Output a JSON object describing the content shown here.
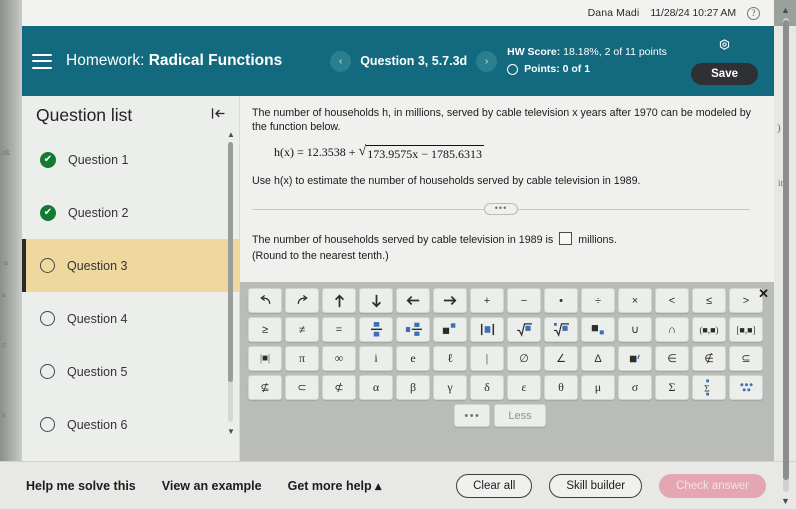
{
  "userbar": {
    "user_name": "Dana Madi",
    "timestamp": "11/28/24 10:27 AM",
    "help_icon": "?"
  },
  "header": {
    "menu_icon": "hamburger-icon",
    "title_label": "Homework:",
    "title_value": "Radical Functions",
    "prev_icon": "‹",
    "next_icon": "›",
    "question_nav_label": "Question 3, 5.7.3d",
    "hw_score": "HW Score: 18.18%, 2 of 11 points",
    "hw_score_bold": "HW Score:",
    "hw_score_rest": " 18.18%, 2 of 11 points",
    "points_label": "Points: 0 of 1",
    "gear_icon": "⚙",
    "save_label": "Save",
    "bg_color": "#136a7f"
  },
  "sidebar": {
    "title": "Question list",
    "collapse_icon": "|←",
    "items": [
      {
        "label": "Question 1",
        "status": "done"
      },
      {
        "label": "Question 2",
        "status": "done"
      },
      {
        "label": "Question 3",
        "status": "current"
      },
      {
        "label": "Question 4",
        "status": "open"
      },
      {
        "label": "Question 5",
        "status": "open"
      },
      {
        "label": "Question 6",
        "status": "open"
      }
    ],
    "highlight_color": "#eed89f",
    "done_color": "#137a33"
  },
  "problem": {
    "intro": "The number of households h, in millions, served by cable television x years after 1970 can be modeled by the function below.",
    "formula_lhs": "h(x) = 12.3538 +",
    "formula_radicand": "173.9575x − 1785.6313",
    "instruction": "Use h(x) to estimate the number of households served by cable television in 1989.",
    "divider_dots": "•••",
    "answer_prompt_before": "The number of households served by cable television in 1989 is",
    "answer_prompt_after": "millions.",
    "answer_value": "",
    "rounding_note": "(Round to the nearest tenth.)"
  },
  "keyboard": {
    "close_icon": "✕",
    "rows": [
      [
        "undo",
        "redo",
        "arrow-up",
        "arrow-down",
        "arrow-left",
        "arrow-right",
        "+",
        "−",
        "•",
        "÷",
        "×",
        "<",
        "≤",
        ">"
      ],
      [
        "≥",
        "≠",
        "=",
        "fraction",
        "mixed-number",
        "exponent",
        "absolute-value",
        "sqrt",
        "nth-root",
        "subscript",
        "∪",
        "∩",
        "(■,■)",
        "[■,■]"
      ],
      [
        "|■|",
        "π",
        "∞",
        "i",
        "e",
        "ℓ",
        "|",
        "∅",
        "∠",
        "Δ",
        "■′",
        "∈",
        "∉",
        "⊆"
      ],
      [
        "⊈",
        "⊂",
        "⊄",
        "α",
        "β",
        "γ",
        "δ",
        "ε",
        "θ",
        "μ",
        "σ",
        "Σ",
        "sum-limits",
        "more-symbols"
      ]
    ],
    "more_dots": "•••",
    "less_label": "Less"
  },
  "actionbar": {
    "links": [
      "Help me solve this",
      "View an example",
      "Get more help ▴"
    ],
    "clear_label": "Clear all",
    "skill_builder_label": "Skill builder",
    "check_answer_label": "Check answer",
    "check_answer_color": "#e3a6b2"
  },
  "bleed": {
    "l1": "ok",
    "l2": "u",
    "l3": "a",
    "l4": "c",
    "l5": "s",
    "r1": ")",
    "r2": "it."
  }
}
